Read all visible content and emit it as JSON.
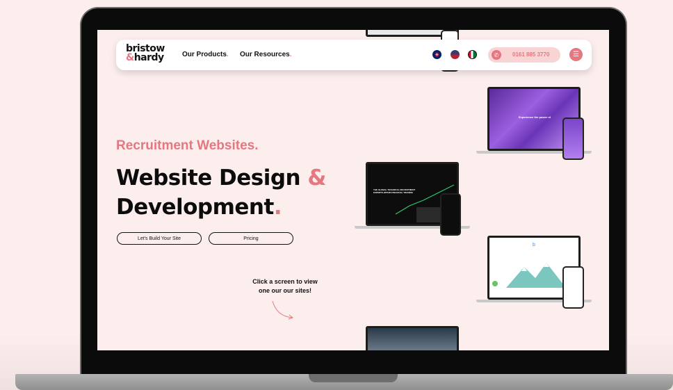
{
  "nav": {
    "logo_line1": "bristow",
    "logo_amp": "&",
    "logo_line2": "hardy",
    "links": [
      {
        "label": "Our Products",
        "dot": "."
      },
      {
        "label": "Our Resources",
        "dot": "."
      }
    ],
    "flags": [
      "uk-flag-icon",
      "us-flag-icon",
      "uae-flag-icon"
    ],
    "phone": "0161 885 3770"
  },
  "hero": {
    "subtitle": "Recruitment Websites.",
    "headline_part1": "Website Design",
    "headline_amp": "&",
    "headline_part2": "Development",
    "headline_dot": "."
  },
  "buttons": {
    "build": "Let's Build Your Site",
    "pricing": "Pricing"
  },
  "note": {
    "line1": "Click a screen to view",
    "line2": "one our our sites!"
  },
  "mockups": {
    "purple_title": "Experience the power of",
    "dark_title": "THE GLOBAL TECHNICAL RECRUITMENT EXPERTS WITHIN FINANCIAL TRADING"
  },
  "colors": {
    "accent": "#e47780",
    "background": "#fdeeee",
    "text": "#0c0c0c"
  }
}
